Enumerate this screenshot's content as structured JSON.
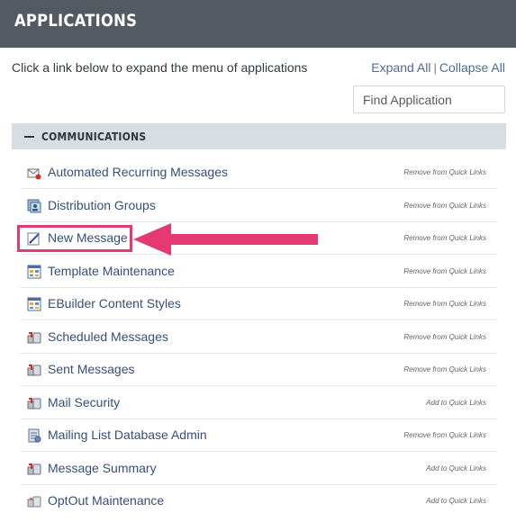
{
  "header": {
    "title": "APPLICATIONS"
  },
  "instructions": "Click a link below to expand the menu of applications",
  "controls": {
    "expand_all": "Expand All",
    "separator": "|",
    "collapse_all": "Collapse All",
    "find_placeholder": "Find Application"
  },
  "section": {
    "title": "COMMUNICATIONS",
    "toggle_icon": "minus-icon",
    "items": [
      {
        "label": "Automated Recurring Messages",
        "action": "Remove from Quick Links",
        "icon": "envelope-alert-icon"
      },
      {
        "label": "Distribution Groups",
        "action": "Remove from Quick Links",
        "icon": "group-icon"
      },
      {
        "label": "New Message",
        "action": "Remove from Quick Links",
        "icon": "compose-icon"
      },
      {
        "label": "Template Maintenance",
        "action": "Remove from Quick Links",
        "icon": "template-icon"
      },
      {
        "label": "EBuilder Content Styles",
        "action": "Remove from Quick Links",
        "icon": "template-icon"
      },
      {
        "label": "Scheduled Messages",
        "action": "Remove from Quick Links",
        "icon": "mailbox-icon"
      },
      {
        "label": "Sent Messages",
        "action": "Remove from Quick Links",
        "icon": "mailbox-icon"
      },
      {
        "label": "Mail Security",
        "action": "Add to Quick Links",
        "icon": "mailbox-icon"
      },
      {
        "label": "Mailing List Database Admin",
        "action": "Remove from Quick Links",
        "icon": "database-icon"
      },
      {
        "label": "Message Summary",
        "action": "Add to Quick Links",
        "icon": "mailbox-icon"
      },
      {
        "label": "OptOut Maintenance",
        "action": "Add to Quick Links",
        "icon": "mailbox-gray-icon"
      }
    ]
  },
  "annotation": {
    "highlight_color": "#e43a72",
    "arrow_color": "#e43a72"
  },
  "colors": {
    "header_bg": "#535a61",
    "section_bg": "#d7dde3",
    "link": "#354f7a"
  }
}
